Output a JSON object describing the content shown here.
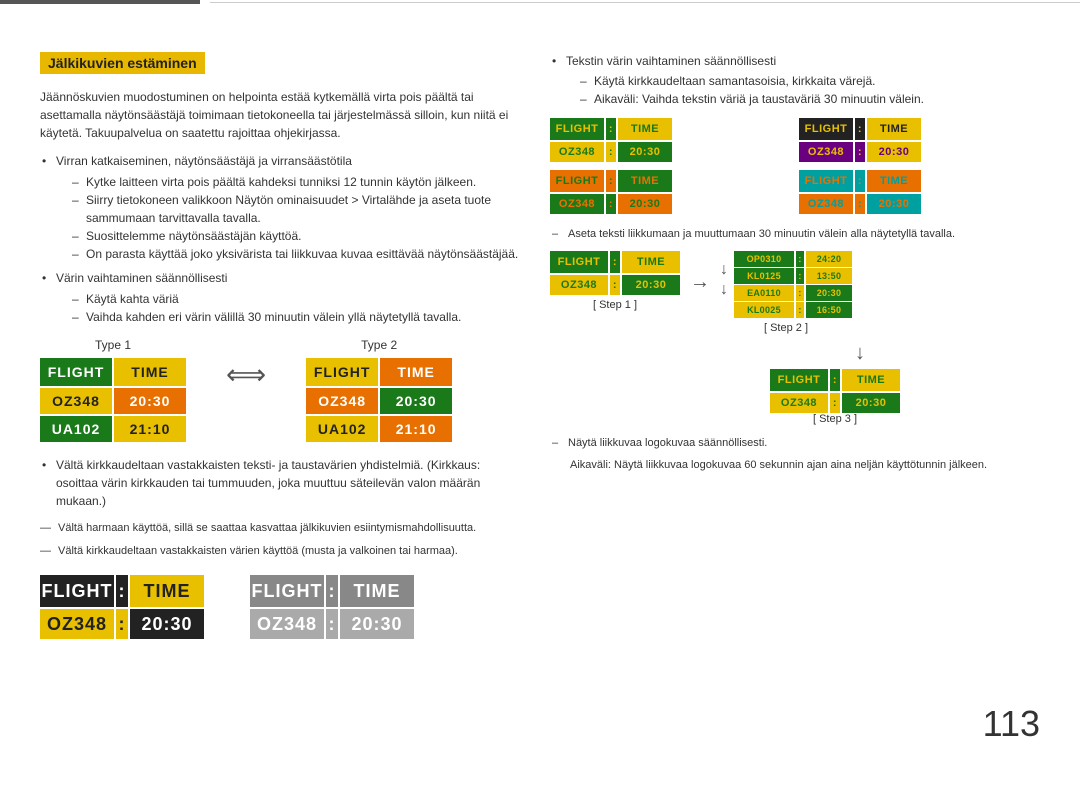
{
  "page": {
    "number": "113"
  },
  "header": {
    "section_title": "Jälkikuvien estäminen"
  },
  "left": {
    "intro_text": "Jäännöskuvien muodostuminen on helpointa estää kytkemällä virta pois päältä tai asettamalla näytönsäästäjä toimimaan tietokoneella tai järjestelmässä silloin, kun niitä ei käytetä. Takuupalvelua on saatettu rajoittaa ohjekirjassa.",
    "bullets": [
      {
        "text": "Virran katkaiseminen, näytönsäästäjä ja virransäästötila",
        "subs": [
          "Kytke laitteen virta pois päältä kahdeksi tunniksi 12 tunnin käytön jälkeen.",
          "Siirry tietokoneen valikkoon Näytön ominaisuudet > Virtalähde ja aseta tuote sammumaan tarvittavalla tavalla.",
          "Suosittelemme näytönsäästäjän käyttöä.",
          "On parasta käyttää joko yksivärista tai liikkuvaa kuvaa esittävää näytönsäästäjää."
        ]
      },
      {
        "text": "Värin vaihtaminen säännöllisesti",
        "subs": [
          "Käytä kahta väriä",
          "Vaihda kahden eri värin välillä 30 minuutin välein yllä näytetyllä tavalla."
        ]
      }
    ],
    "type1_label": "Type 1",
    "type2_label": "Type 2",
    "type1": {
      "header": [
        "FLIGHT",
        "TIME"
      ],
      "rows": [
        [
          "OZ348",
          "20:30"
        ],
        [
          "UA102",
          "21:10"
        ]
      ]
    },
    "type2": {
      "header": [
        "FLIGHT",
        "TIME"
      ],
      "rows": [
        [
          "OZ348",
          "20:30"
        ],
        [
          "UA102",
          "21:10"
        ]
      ]
    },
    "bottom_bullets": [
      "Vältä kirkkaudeltaan vastakkaisten teksti- ja taustavärien yhdistelmiä. (Kirkkaus: osoittaa värin kirkkauden tai tummuuden, joka muuttuu säteilevän valon määrän mukaan.)"
    ],
    "dash_notes": [
      "Vältä harmaan käyttöä, sillä se saattaa kasvattaa jälkikuvien esiintymismahdollisuutta.",
      "Vältä kirkkaudeltaan vastakkaisten värien käyttöä (musta ja valkoinen tai harmaa)."
    ],
    "bottom_panels": [
      {
        "type": "black_yellow",
        "header": [
          "FLIGHT",
          ":",
          "TIME"
        ],
        "data": [
          "OZ348",
          ":",
          "20:30"
        ]
      },
      {
        "type": "gray",
        "header": [
          "FLIGHT",
          ":",
          "TIME"
        ],
        "data": [
          "OZ348",
          ":",
          "20:30"
        ]
      }
    ]
  },
  "right": {
    "bullet": {
      "text": "Tekstin värin vaihtaminen säännöllisesti",
      "subs": [
        "Käytä kirkkaudeltaan samantasoisia, kirkkaita värejä.",
        "Aikaväli: Vaihda tekstin väriä ja taustaväriä 30 minuutin välein."
      ]
    },
    "color_grid": [
      {
        "bg_header": "#1a7a1a",
        "fg_header": "#e8c000",
        "text_header": [
          "FLIGHT",
          ":",
          "TIME"
        ],
        "bg_data": "#e8c000",
        "fg_data": "#1a7a1a",
        "text_data": [
          "OZ348",
          ":",
          "20:30"
        ]
      },
      {
        "bg_header": "#222",
        "fg_header": "#e8c000",
        "text_header": [
          "FLIGHT",
          ":",
          "TIME"
        ],
        "bg_data": "#6a0080",
        "fg_data": "#e8c000",
        "text_data": [
          "OZ348",
          ":",
          "20:30"
        ]
      },
      {
        "bg_header": "#e87000",
        "fg_header": "#1a7a1a",
        "text_header": [
          "FLIGHT",
          ":",
          "TIME"
        ],
        "bg_data": "#1a7a1a",
        "fg_data": "#e87000",
        "text_data": [
          "OZ348",
          ":",
          "20:30"
        ]
      },
      {
        "bg_header": "#00a0a0",
        "fg_header": "#e87000",
        "text_header": [
          "FLIGHT",
          ":",
          "TIME"
        ],
        "bg_data": "#e87000",
        "fg_data": "#00a0a0",
        "text_data": [
          "OZ348",
          ":",
          "20:30"
        ]
      }
    ],
    "step_note": "Aseta teksti liikkumaan ja muuttumaan 30 minuutin välein alla näytetyllä tavalla.",
    "step1": {
      "label": "[ Step 1 ]",
      "header": [
        "FLIGHT",
        ":",
        "TIME"
      ],
      "data": [
        "OZ348",
        ":",
        "20:30"
      ]
    },
    "step2": {
      "label": "[ Step 2 ]",
      "rows": [
        [
          "OP0310",
          ":",
          "24:20"
        ],
        [
          "KL0125",
          ":",
          "13:50"
        ],
        [
          "EA0110",
          ":",
          "20:30"
        ],
        [
          "KL0025",
          ":",
          "16:50"
        ]
      ]
    },
    "step3": {
      "label": "[ Step 3 ]",
      "header": [
        "FLIGHT",
        ":",
        "TIME"
      ],
      "data": [
        "OZ348",
        ":",
        "20:30"
      ]
    },
    "logo_note": "Näytä liikkuvaa logokuvaa säännöllisesti.",
    "logo_note2": "Aikaväli: Näytä liikkuvaa logokuvaa 60 sekunnin ajan aina neljän käyttötunnin jälkeen."
  }
}
